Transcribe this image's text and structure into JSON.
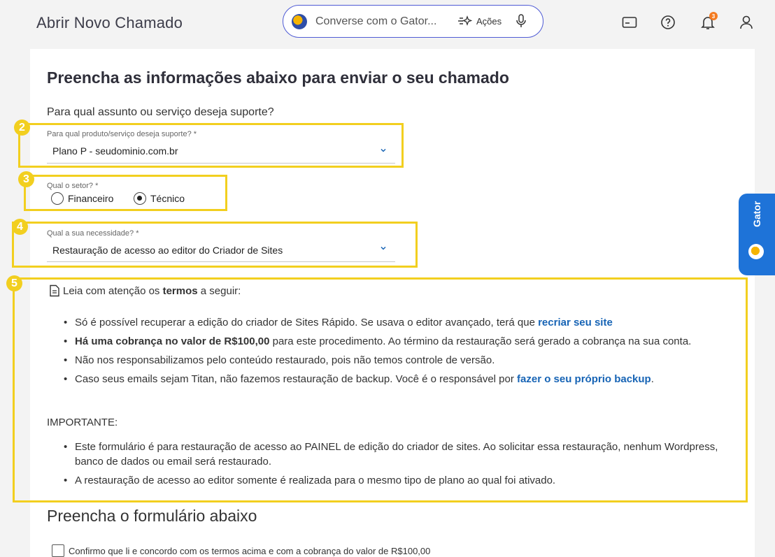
{
  "header": {
    "title": "Abrir Novo Chamado",
    "search_placeholder": "Converse com o Gator...",
    "actions_label": "Ações",
    "notification_count": "3"
  },
  "form": {
    "heading": "Preencha as informações abaixo para enviar o seu chamado",
    "subject_question": "Para qual assunto ou serviço deseja suporte?",
    "product": {
      "label": "Para qual produto/serviço deseja suporte? *",
      "value": "Plano P - seudominio.com.br"
    },
    "sector": {
      "label": "Qual o setor? *",
      "options": [
        "Financeiro",
        "Técnico"
      ],
      "selected": "Técnico"
    },
    "need": {
      "label": "Qual a sua necessidade? *",
      "value": "Restauração de acesso ao editor do Criador de Sites"
    },
    "step_numbers": [
      "2",
      "3",
      "4",
      "5"
    ]
  },
  "terms": {
    "intro_prefix": "Leia com atenção os ",
    "intro_bold": "termos",
    "intro_suffix": " a seguir:",
    "items": [
      {
        "text": "Só é possível recuperar a edição do criador de Sites Rápido. Se usava o editor avançado, terá que ",
        "link": "recriar seu site"
      },
      {
        "bold": "Há uma cobrança no valor de R$100,00",
        "text": " para este procedimento. Ao término da restauração será gerado a cobrança na sua conta."
      },
      {
        "text": "Não nos responsabilizamos pelo conteúdo restaurado, pois não temos controle de versão."
      },
      {
        "text": "Caso seus emails sejam Titan, não fazemos restauração de backup. Você é o responsável por ",
        "link": "fazer o seu próprio backup",
        "suffix": "."
      }
    ],
    "important_label": "IMPORTANTE:",
    "important_items": [
      "Este formulário é para restauração de acesso ao PAINEL de edição do criador de sites. Ao solicitar essa restauração, nenhum Wordpress, banco de dados ou email será restaurado.",
      "A restauração de acesso ao editor somente é realizada para o mesmo tipo de plano ao qual foi ativado."
    ]
  },
  "bottom": {
    "heading": "Preencha o formulário abaixo",
    "confirm_label": "Confirmo que li e concordo com os termos acima e com a cobrança do valor de R$100,00"
  },
  "side_tab": {
    "label": "Gator"
  },
  "colors": {
    "highlight": "#f2cf1f",
    "link": "#1764b5",
    "accent": "#4f5bd5",
    "side_tab": "#1e73d8"
  }
}
